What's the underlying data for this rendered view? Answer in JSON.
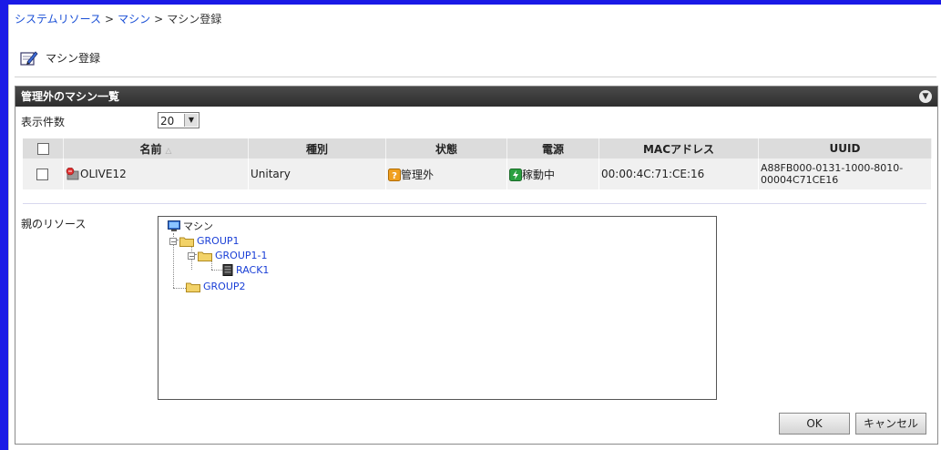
{
  "breadcrumb": {
    "items": [
      "システムリソース",
      "マシン",
      "マシン登録"
    ],
    "separator": ">"
  },
  "page": {
    "title": "マシン登録",
    "icon": "edit-form-icon"
  },
  "panel": {
    "title": "管理外のマシン一覧",
    "collapse_icon": "collapse-circle-icon",
    "per_page_label": "表示件数",
    "per_page_value": "20",
    "per_page_arrow": "▼"
  },
  "table": {
    "columns": [
      "名前",
      "種別",
      "状態",
      "電源",
      "MACアドレス",
      "UUID"
    ],
    "sort_indicator": "△",
    "rows": [
      {
        "name": "OLIVE12",
        "type": "Unitary",
        "status": "管理外",
        "power": "稼動中",
        "mac": "00:00:4C:71:CE:16",
        "uuid": "A88FB000-0131-1000-8010-00004C71CE16"
      }
    ]
  },
  "parent_resource": {
    "label": "親のリソース",
    "tree": {
      "root": "マシン",
      "group1": "GROUP1",
      "group1_1": "GROUP1-1",
      "rack1": "RACK1",
      "group2": "GROUP2",
      "collapse_glyph": "−"
    }
  },
  "buttons": {
    "ok": "OK",
    "cancel": "キャンセル"
  },
  "colors": {
    "frame": "#1a1ae6",
    "panel_header": "#3a3a3a",
    "link": "#1a4fd6",
    "tree_link": "#1a3fd6",
    "status_unmanaged": "#f0a020",
    "power_on": "#2aa040"
  }
}
